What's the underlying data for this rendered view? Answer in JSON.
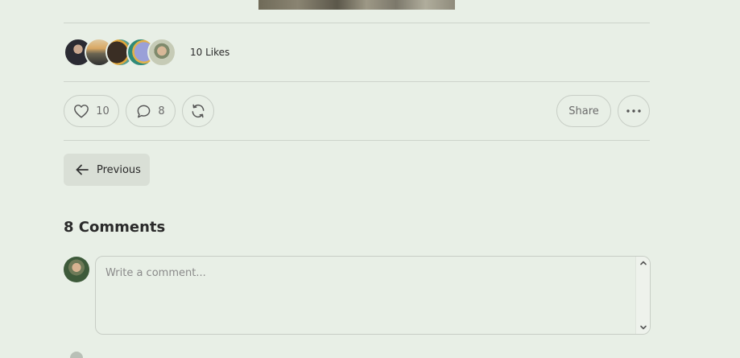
{
  "likes": {
    "text": "10 Likes",
    "avatars": [
      "avatar-1",
      "avatar-2",
      "avatar-3",
      "avatar-4",
      "avatar-5"
    ]
  },
  "actions": {
    "like_count": "10",
    "comment_count": "8",
    "share_label": "Share"
  },
  "navigation": {
    "previous_label": "Previous"
  },
  "comments": {
    "title": "8 Comments",
    "placeholder": "Write a comment..."
  },
  "icons": {
    "like": "heart-icon",
    "comment": "speech-bubble-icon",
    "repost": "repost-icon",
    "more": "ellipsis-icon",
    "previous": "arrow-left-icon"
  },
  "colors": {
    "background": "#e8efe6",
    "border": "#c7cdc5",
    "button_bg": "#d9dfd6",
    "text": "#2a2a2a",
    "muted_text": "#6b6b6b"
  }
}
